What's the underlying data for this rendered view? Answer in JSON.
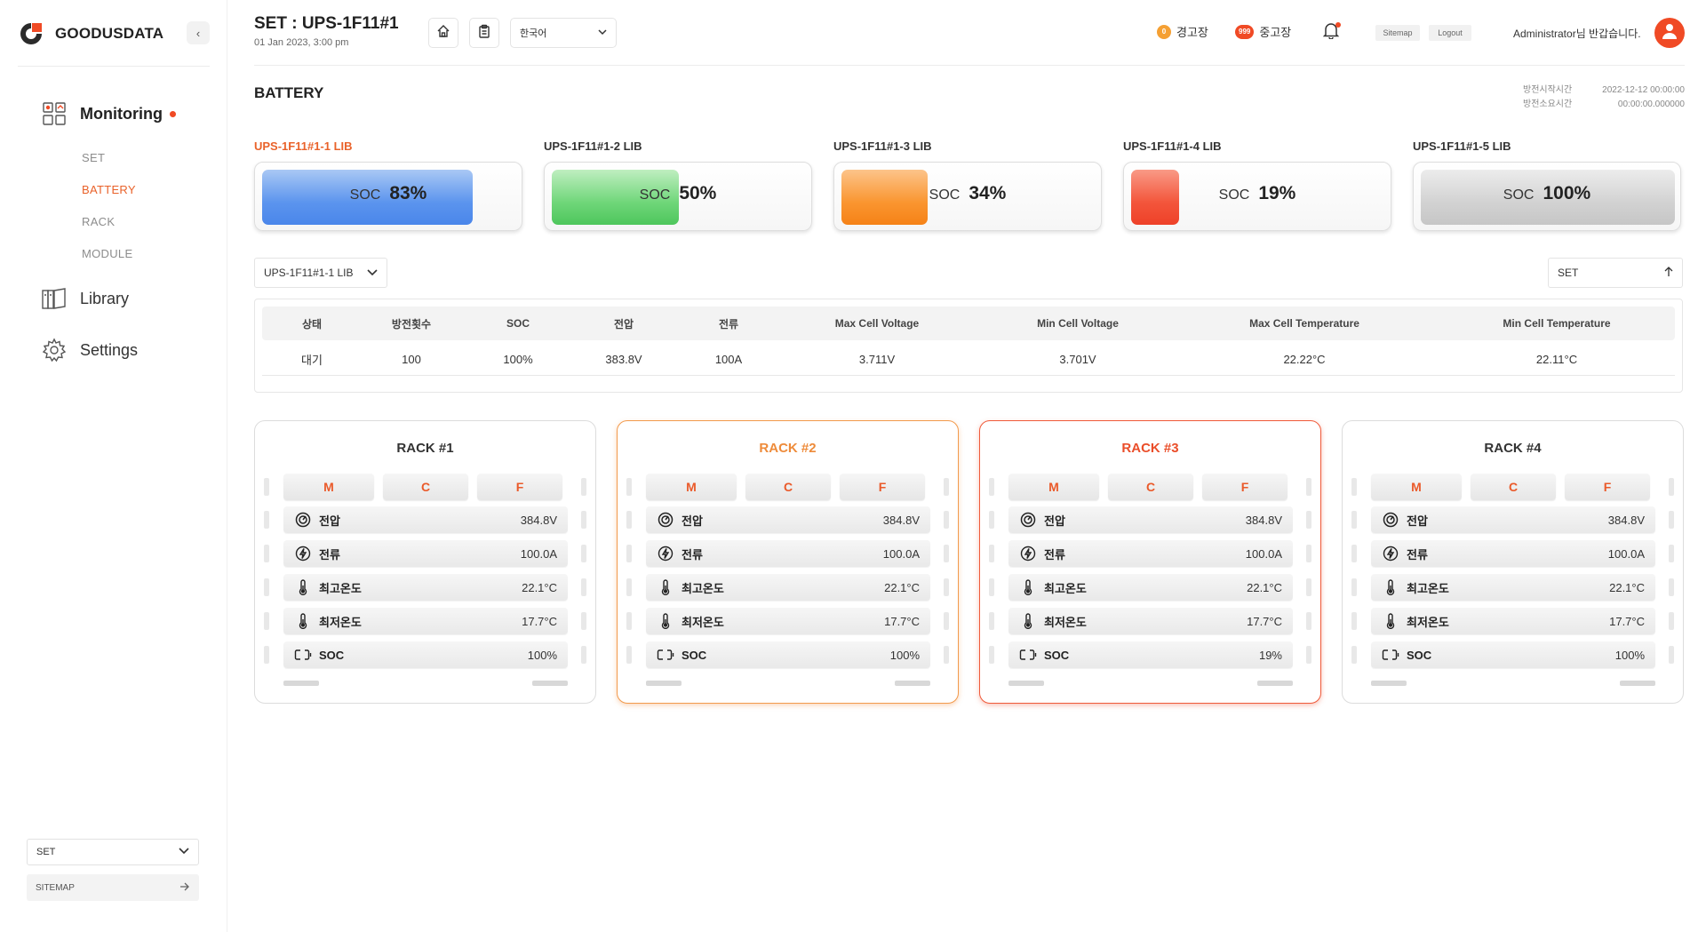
{
  "app": {
    "name": "GOODUSDATA",
    "brand_color": "#f04a25",
    "accent_color": "#e9622a"
  },
  "sidebar": {
    "collapse_icon": "chevron-left-icon",
    "nav": [
      {
        "label": "Monitoring",
        "icon": "monitoring-grid-icon",
        "active": true
      },
      {
        "label": "Library",
        "icon": "library-book-icon"
      },
      {
        "label": "Settings",
        "icon": "gear-icon"
      }
    ],
    "sub_items": [
      {
        "label": "SET"
      },
      {
        "label": "BATTERY",
        "active": true
      },
      {
        "label": "RACK"
      },
      {
        "label": "MODULE"
      }
    ],
    "select_value": "SET",
    "sitemap_label": "SITEMAP"
  },
  "header": {
    "set_title": "SET : UPS-1F11#1",
    "date": "01 Jan 2023, 3:00 pm",
    "language": "한국어",
    "warning": {
      "count": "0",
      "label": "경고장",
      "color": "#f5a033"
    },
    "fault": {
      "count": "999",
      "label": "중고장",
      "color": "#f04a25"
    },
    "sitemap_btn": "Sitemap",
    "logout_btn": "Logout",
    "greeting": "Administrator님 반갑습니다."
  },
  "main": {
    "title": "BATTERY",
    "meta": {
      "start_label": "방전시작시간",
      "start_value": "2022-12-12 00:00:00",
      "duration_label": "방전소요시간",
      "duration_value": "00:00:00.000000"
    },
    "libs": [
      {
        "name": "UPS-1F11#1-1 LIB",
        "soc_label": "SOC",
        "soc": "83%",
        "level": 0.83,
        "active": true
      },
      {
        "name": "UPS-1F11#1-2 LIB",
        "soc_label": "SOC",
        "soc": "50%",
        "level": 0.5
      },
      {
        "name": "UPS-1F11#1-3 LIB",
        "soc_label": "SOC",
        "soc": "34%",
        "level": 0.34
      },
      {
        "name": "UPS-1F11#1-4 LIB",
        "soc_label": "SOC",
        "soc": "19%",
        "level": 0.19
      },
      {
        "name": "UPS-1F11#1-5 LIB",
        "soc_label": "SOC",
        "soc": "100%",
        "level": 1.0
      }
    ],
    "lib_select": "UPS-1F11#1-1 LIB",
    "sort_select": "SET",
    "table": {
      "headers": [
        "상태",
        "방전횟수",
        "SOC",
        "전압",
        "전류",
        "Max Cell Voltage",
        "Min Cell Voltage",
        "Max Cell Temperature",
        "Min Cell Temperature"
      ],
      "row": [
        "대기",
        "100",
        "100%",
        "383.8V",
        "100A",
        "3.711V",
        "3.701V",
        "22.22°C",
        "22.11°C"
      ]
    },
    "racks": [
      {
        "title": "RACK #1",
        "status": "normal",
        "tabs": [
          "M",
          "C",
          "F"
        ],
        "metrics": [
          {
            "label": "전압",
            "value": "384.8V",
            "icon": "gauge-icon"
          },
          {
            "label": "전류",
            "value": "100.0A",
            "icon": "bolt-icon"
          },
          {
            "label": "최고온도",
            "value": "22.1°C",
            "icon": "thermometer-icon"
          },
          {
            "label": "최저온도",
            "value": "17.7°C",
            "icon": "thermometer-icon"
          },
          {
            "label": "SOC",
            "value": "100%",
            "icon": "battery-icon"
          }
        ]
      },
      {
        "title": "RACK #2",
        "status": "warning",
        "tabs": [
          "M",
          "C",
          "F"
        ],
        "metrics": [
          {
            "label": "전압",
            "value": "384.8V",
            "icon": "gauge-icon"
          },
          {
            "label": "전류",
            "value": "100.0A",
            "icon": "bolt-icon"
          },
          {
            "label": "최고온도",
            "value": "22.1°C",
            "icon": "thermometer-icon"
          },
          {
            "label": "최저온도",
            "value": "17.7°C",
            "icon": "thermometer-icon"
          },
          {
            "label": "SOC",
            "value": "100%",
            "icon": "battery-icon"
          }
        ]
      },
      {
        "title": "RACK #3",
        "status": "fault",
        "tabs": [
          "M",
          "C",
          "F"
        ],
        "metrics": [
          {
            "label": "전압",
            "value": "384.8V",
            "icon": "gauge-icon"
          },
          {
            "label": "전류",
            "value": "100.0A",
            "icon": "bolt-icon"
          },
          {
            "label": "최고온도",
            "value": "22.1°C",
            "icon": "thermometer-icon"
          },
          {
            "label": "최저온도",
            "value": "17.7°C",
            "icon": "thermometer-icon"
          },
          {
            "label": "SOC",
            "value": "19%",
            "icon": "battery-icon"
          }
        ]
      },
      {
        "title": "RACK #4",
        "status": "normal",
        "tabs": [
          "M",
          "C",
          "F"
        ],
        "metrics": [
          {
            "label": "전압",
            "value": "384.8V",
            "icon": "gauge-icon"
          },
          {
            "label": "전류",
            "value": "100.0A",
            "icon": "bolt-icon"
          },
          {
            "label": "최고온도",
            "value": "22.1°C",
            "icon": "thermometer-icon"
          },
          {
            "label": "최저온도",
            "value": "17.7°C",
            "icon": "thermometer-icon"
          },
          {
            "label": "SOC",
            "value": "100%",
            "icon": "battery-icon"
          }
        ]
      }
    ]
  }
}
